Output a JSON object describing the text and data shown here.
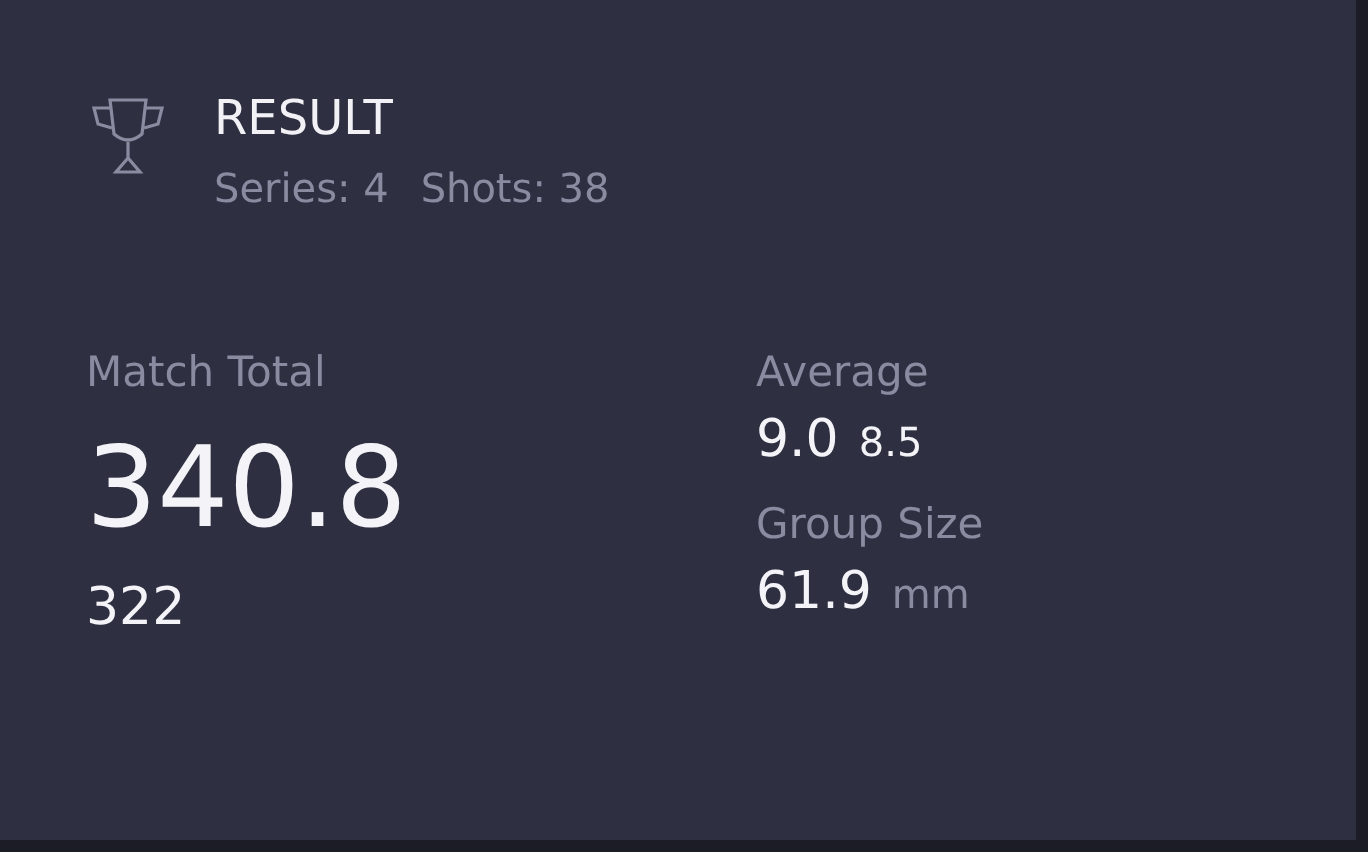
{
  "header": {
    "title": "RESULT",
    "series": "Series: 4",
    "shots": "Shots: 38"
  },
  "match_total": {
    "label": "Match Total",
    "value": "340.8",
    "secondary": "322"
  },
  "average": {
    "label": "Average",
    "value": "9.0",
    "secondary": "8.5"
  },
  "group_size": {
    "label": "Group Size",
    "value": "61.9",
    "unit": "mm"
  }
}
